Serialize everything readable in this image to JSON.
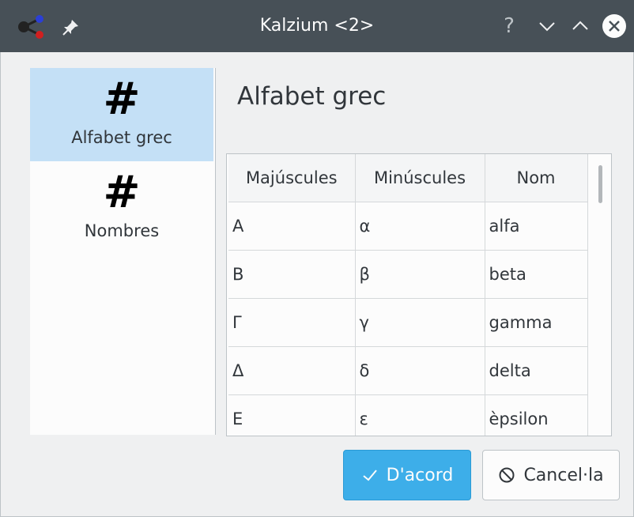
{
  "window": {
    "title": "Kalzium <2>",
    "help_label": "?",
    "icons": [
      "kalzium-app-icon",
      "pin-icon",
      "help-icon",
      "minimize-icon",
      "maximize-icon",
      "close-icon"
    ]
  },
  "sidebar": {
    "items": [
      {
        "icon": "#",
        "label": "Alfabet grec",
        "selected": true
      },
      {
        "icon": "#",
        "label": "Nombres",
        "selected": false
      }
    ]
  },
  "main": {
    "title": "Alfabet grec",
    "table": {
      "headers": [
        "Majúscules",
        "Minúscules",
        "Nom"
      ],
      "rows": [
        [
          "Α",
          "α",
          "alfa"
        ],
        [
          "Β",
          "β",
          "beta"
        ],
        [
          "Γ",
          "γ",
          "gamma"
        ],
        [
          "Δ",
          "δ",
          "delta"
        ],
        [
          "Ε",
          "ε",
          "èpsilon"
        ]
      ]
    }
  },
  "buttons": {
    "ok_label": "D'acord",
    "cancel_label": "Cancel·la"
  },
  "colors": {
    "titlebar": "#475057",
    "selection": "#c4e0f6",
    "accent": "#3daee9"
  }
}
